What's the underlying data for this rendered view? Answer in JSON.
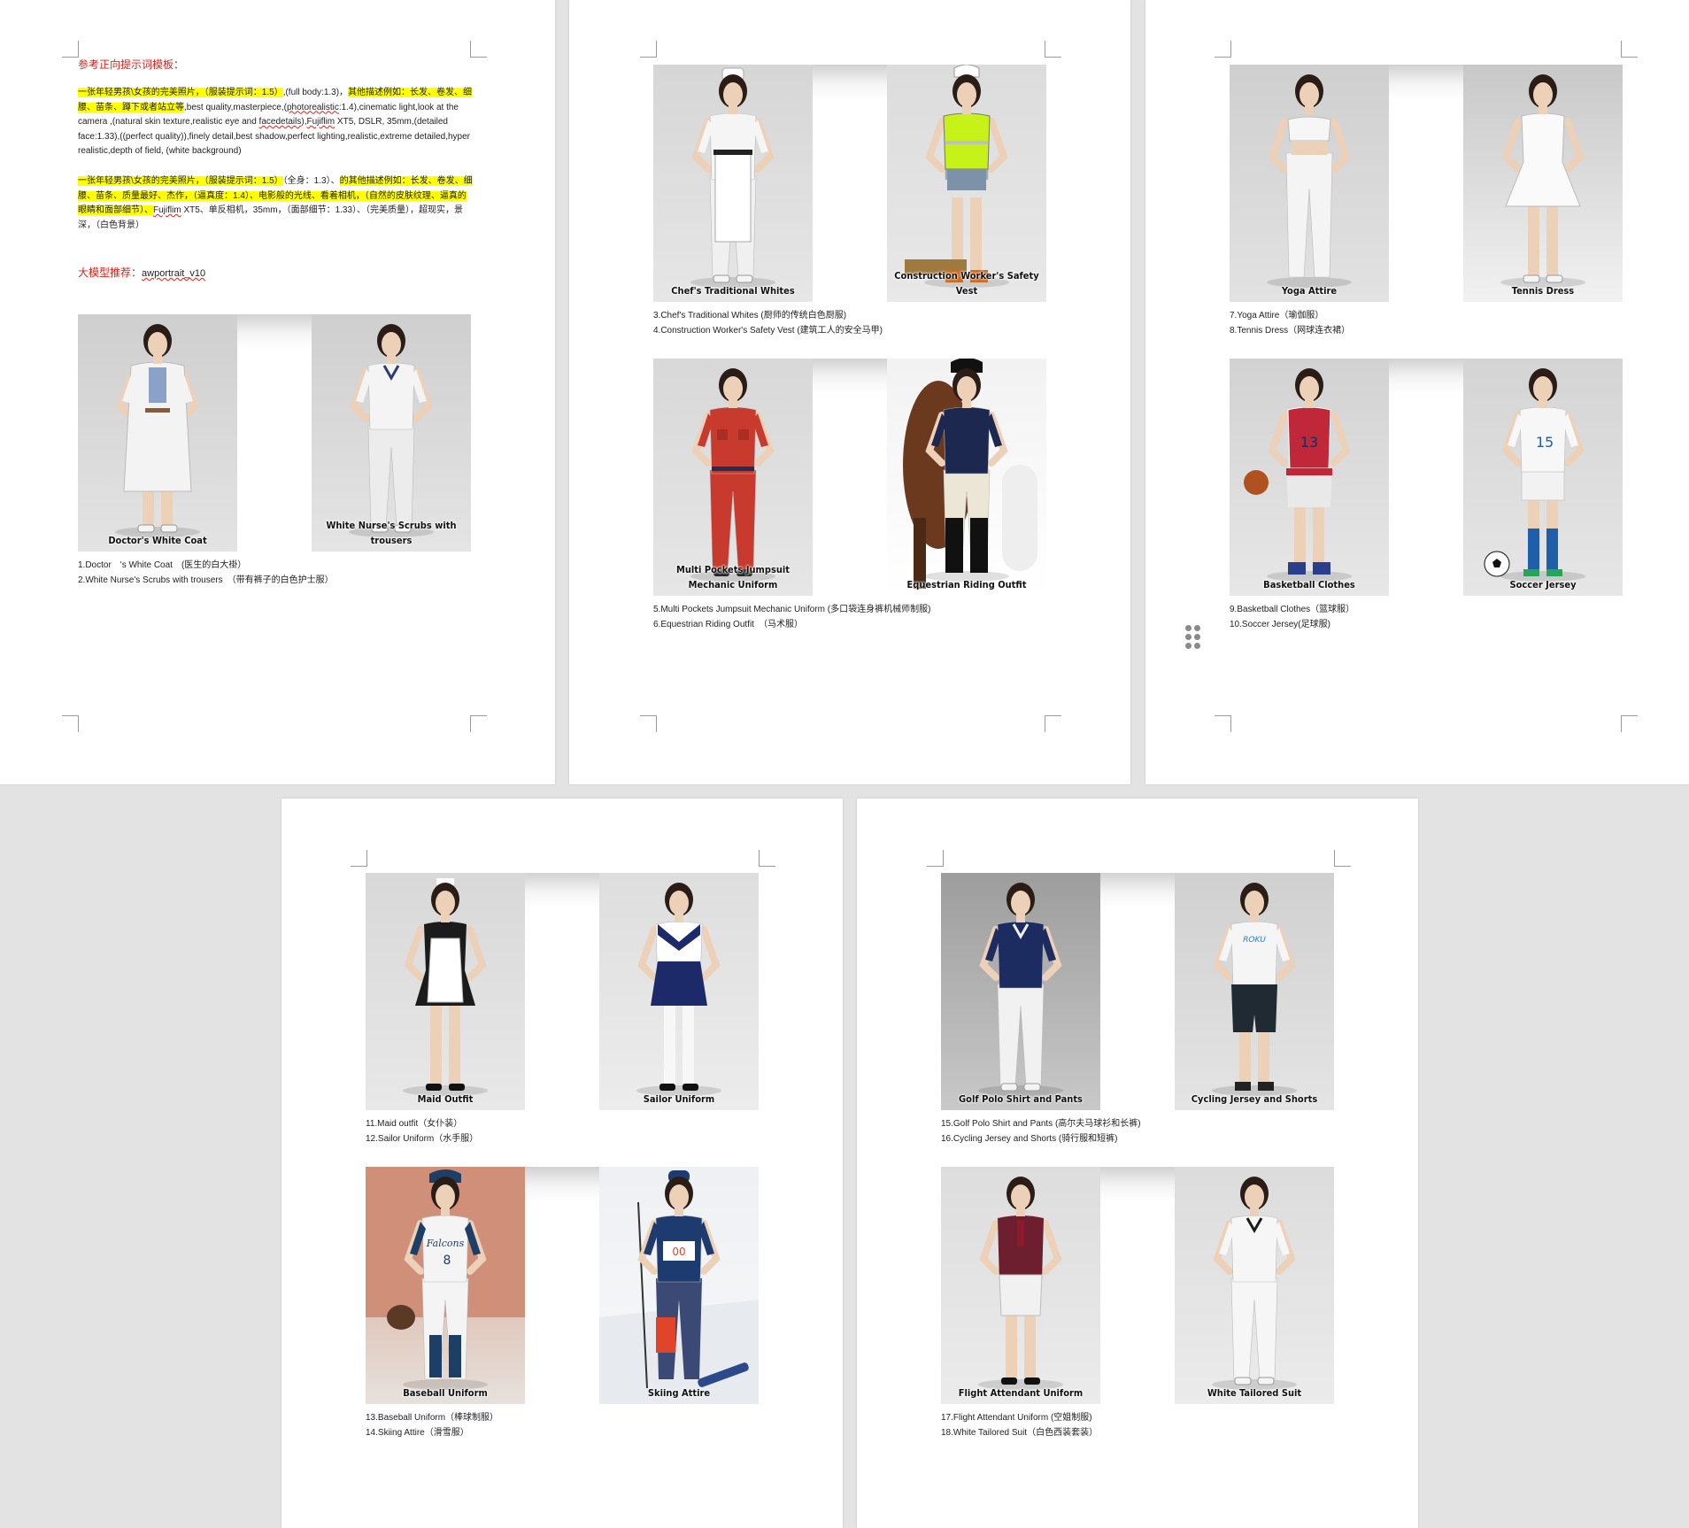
{
  "document": {
    "heading": "参考正向提示词模板：",
    "prompt_en": {
      "p1": "一张年轻男孩\\女孩的完美照片，（服装提示词：1.5）",
      "p2": ",(full body:1.3)，",
      "p3": "其他描述例如：长发、卷发、细腰、苗条、蹲下或者站立等",
      "p4": ",best quality,masterpiece,(",
      "p5": "photorealistic",
      "p6": ":1.4),cinematic light,look at the camera ,(natural skin texture,realistic eye and ",
      "p7": "facedetails",
      "p8": "),",
      "p9": "Fujiflim",
      "p10": " XT5, DSLR, 35mm,(detailed face:1.33),((perfect quality)),finely detail,best shadow,perfect lighting,realistic,extreme detailed,hyper realistic,depth of field, (white background)"
    },
    "prompt_zh": {
      "p1": "一张年轻男孩\\女孩的完美照片，（服装提示词：1.5）",
      "p2": "（全身：1.3）、",
      "p3": "的其他描述例如：长发、卷发、细腰、苗条、质量最好、杰作，（逼真度：1.4）、电影般的光线、看着相机，（自然的皮肤纹理、逼真的眼睛和面部细节）、",
      "p4": "Fujiflim",
      "p5": " XT5、单反相机，35mm，（面部细节：1.33）、（完美质量），超现实，景深，（白色背景）"
    },
    "model_label": "大模型推荐：",
    "model_name": "awportrait_v10"
  },
  "photos": [
    {
      "caption": "Doctor's White Coat",
      "top": "#cfcfcf",
      "bottom": "#e3e3e3",
      "outfit": "#f3f3f3",
      "legs": "#f3f3f3",
      "accent": "#f7f7f7",
      "kind": "coat"
    },
    {
      "caption": "White Nurse's Scrubs with trousers",
      "top": "#cfcfcf",
      "bottom": "#e4e4e4",
      "outfit": "#f4f4f4",
      "legs": "#ececec",
      "accent": "#2c3e6b",
      "kind": "pants"
    },
    {
      "caption": "Chef's Traditional Whites",
      "top": "#d6d6d6",
      "bottom": "#e6e6e6",
      "outfit": "#f5f5f5",
      "legs": "#f0f0f0",
      "accent": "#222222",
      "kind": "apron"
    },
    {
      "caption": "Construction Worker's Safety Vest",
      "top": "#dcdcdc",
      "bottom": "#e8e8e8",
      "outfit": "#c6f21a",
      "legs": "#e3c9a9",
      "accent": "#3b3b3b",
      "kind": "vest"
    },
    {
      "caption": "Multi Pockets Jumpsuit Mechanic Uniform",
      "top": "#d8d8d8",
      "bottom": "#e6e6e6",
      "outfit": "#c83a2d",
      "legs": "#c83a2d",
      "accent": "#1f2f55",
      "kind": "jumpsuit"
    },
    {
      "caption": "Equestrian Riding Outfit",
      "top": "#f2f2f2",
      "bottom": "#ffffff",
      "outfit": "#1d2850",
      "legs": "#ece6d6",
      "accent": "#6b3a1e",
      "kind": "horse"
    },
    {
      "caption": "Yoga Attire",
      "top": "#cfcfcf",
      "bottom": "#e2e2e2",
      "outfit": "#f6f6f6",
      "legs": "#f4f4f4",
      "accent": "#e9c9ad",
      "kind": "yoga"
    },
    {
      "caption": "Tennis Dress",
      "top": "#c8c8c8",
      "bottom": "#f1f1f1",
      "outfit": "#fafafa",
      "legs": "#e9c9ad",
      "accent": "#ffffff",
      "kind": "dress"
    },
    {
      "caption": "Basketball Clothes",
      "top": "#d2d2d2",
      "bottom": "#e7e7e7",
      "outfit": "#c0283a",
      "legs": "#e9c9ad",
      "accent": "#b0521f",
      "kind": "basket"
    },
    {
      "caption": "Soccer Jersey",
      "top": "#d4d4d4",
      "bottom": "#e6e6e6",
      "outfit": "#f7f7f7",
      "legs": "#1f5fa8",
      "accent": "#111111",
      "kind": "soccer"
    },
    {
      "caption": "Maid Outfit",
      "top": "#d8d8d8",
      "bottom": "#e8e8e8",
      "outfit": "#1b1b1b",
      "legs": "#e9c9ad",
      "accent": "#ffffff",
      "kind": "maid"
    },
    {
      "caption": "Sailor Uniform",
      "top": "#dedede",
      "bottom": "#ececec",
      "outfit": "#ffffff",
      "legs": "#f7f7f7",
      "accent": "#1d2a6a",
      "kind": "sailor"
    },
    {
      "caption": "Golf Polo Shirt and Pants",
      "top": "#9d9d9d",
      "bottom": "#c8c8c8",
      "outfit": "#1c2b60",
      "legs": "#f1f1f1",
      "accent": "#f1f1f1",
      "kind": "pants"
    },
    {
      "caption": "Cycling Jersey and Shorts",
      "top": "#d0d0d0",
      "bottom": "#e4e4e4",
      "outfit": "#f5f5f5",
      "legs": "#1f2a33",
      "accent": "#1f2a33",
      "kind": "cycle"
    },
    {
      "caption": "Baseball Uniform",
      "top": "#d89c86",
      "bottom": "#e6e1dc",
      "outfit": "#f4f4f4",
      "legs": "#f4f4f4",
      "accent": "#1d3f66",
      "kind": "baseball"
    },
    {
      "caption": "Skiing Attire",
      "top": "#eef0f3",
      "bottom": "#f7f8fa",
      "outfit": "#1d3b6e",
      "legs": "#3a4a74",
      "accent": "#e0442b",
      "kind": "ski"
    },
    {
      "caption": "Flight Attendant Uniform",
      "top": "#dddddd",
      "bottom": "#ebebeb",
      "outfit": "#6d1f2f",
      "legs": "#f1f1f1",
      "accent": "#f2f2f2",
      "kind": "skirt"
    },
    {
      "caption": "White Tailored Suit",
      "top": "#dcdcdc",
      "bottom": "#ebebeb",
      "outfit": "#f6f6f6",
      "legs": "#f6f6f6",
      "accent": "#1a1a1a",
      "kind": "pants"
    }
  ],
  "desc": [
    [
      "1.Doctor　's White Coat　(医生的白大褂）",
      "2.White Nurse's Scrubs with trousers　（带有裤子的白色护士服）"
    ],
    [
      "3.Chef's Traditional Whites (厨师的传统白色厨服)",
      "4.Construction Worker's Safety Vest (建筑工人的安全马甲)"
    ],
    [
      "5.Multi Pockets Jumpsuit Mechanic Uniform (多口袋连身裤机械师制服)",
      "6.Equestrian Riding Outfit　（马术服）"
    ],
    [
      "7.Yoga Attire（瑜伽服）",
      "8.Tennis Dress（网球连衣裙）"
    ],
    [
      "9.Basketball Clothes（篮球服）",
      "10.Soccer Jersey(足球服)"
    ],
    [
      "11.Maid outfit（女仆装）",
      "12.Sailor Uniform（水手服）"
    ],
    [
      "13.Baseball Uniform（棒球制服）",
      "14.Skiing Attire（滑雪服）"
    ],
    [
      "15.Golf Polo Shirt and Pants (高尔夫马球衫和长裤)",
      "16.Cycling Jersey and Shorts (骑行服和短裤)"
    ],
    [
      "17.Flight Attendant Uniform (空姐制服)",
      "18.White Tailored Suit（白色西装套装）"
    ]
  ],
  "icons": {
    "drag_handle": "drag-handle-icon"
  }
}
